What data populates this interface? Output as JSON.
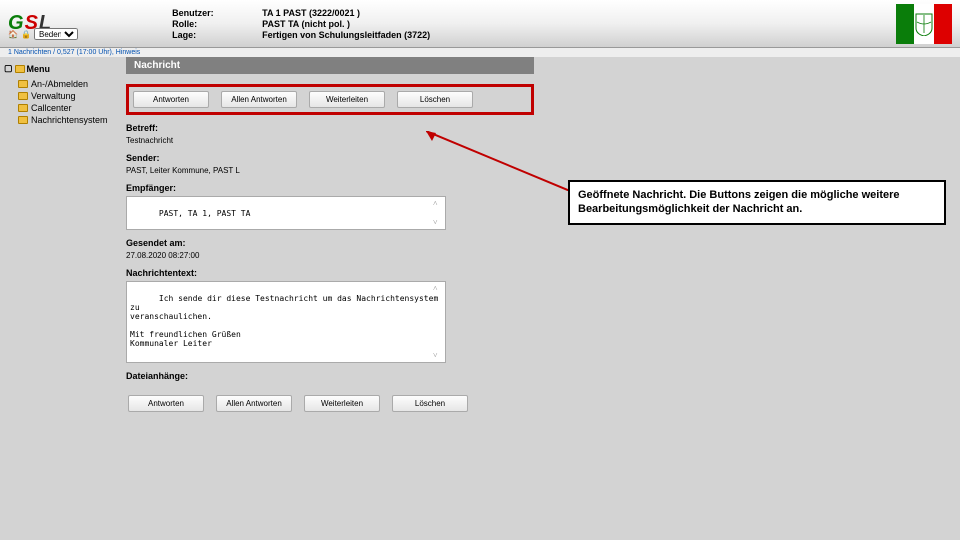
{
  "header": {
    "logo": {
      "g": "G",
      "s": "S",
      "l": "L"
    },
    "labels": {
      "user": "Benutzer:",
      "role": "Rolle:",
      "lage": "Lage:"
    },
    "values": {
      "user": "TA 1 PAST (3222/0021 )",
      "role": "PAST TA (nicht pol. )",
      "lage": "Fertigen von Schulungsleitfaden (3722)"
    },
    "select": "Beden",
    "status": "1 Nachrichten / 0,527 (17:00 Uhr), Hinweis"
  },
  "sidebar": {
    "root": "Menu",
    "items": [
      {
        "label": "An-/Abmelden"
      },
      {
        "label": "Verwaltung"
      },
      {
        "label": "Callcenter"
      },
      {
        "label": "Nachrichtensystem"
      }
    ]
  },
  "message": {
    "title": "Nachricht",
    "buttons": {
      "reply": "Antworten",
      "replyAll": "Allen Antworten",
      "forward": "Weiterleiten",
      "delete": "Löschen"
    },
    "labels": {
      "subject": "Betreff:",
      "sender": "Sender:",
      "recipients": "Empfänger:",
      "sentAt": "Gesendet am:",
      "body": "Nachrichtentext:",
      "attachments": "Dateianhänge:"
    },
    "values": {
      "subject": "Testnachricht",
      "sender": "PAST, Leiter Kommune, PAST L",
      "recipients": "PAST, TA 1, PAST TA",
      "sentAt": "27.08.2020 08:27:00",
      "body": "Ich sende dir diese Testnachricht um das Nachrichtensystem zu\nveranschaulichen.\n\nMit freundlichen Grüßen\nKommunaler Leiter"
    }
  },
  "callout": "Geöffnete Nachricht. Die Buttons zeigen die mögliche weitere Bearbeitungsmöglichkeit der Nachricht an."
}
